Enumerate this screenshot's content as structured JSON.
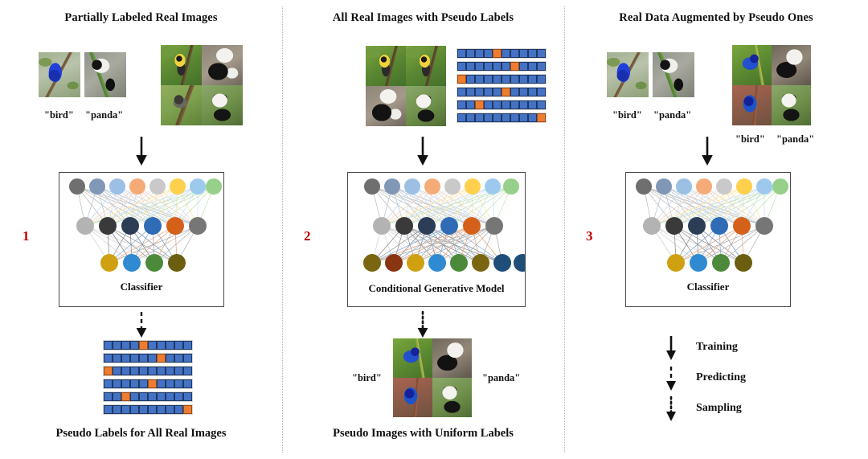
{
  "columns": [
    {
      "step": "1",
      "title": "Partially Labeled Real Images",
      "labeled": {
        "bird": "\"bird\"",
        "panda": "\"panda\""
      },
      "model": {
        "caption": "Classifier"
      },
      "bottom_caption": "Pseudo Labels for All Real Images",
      "arrow_in": "training-arrow-solid",
      "arrow_out": "predicting-arrow-dashed"
    },
    {
      "step": "2",
      "title": "All Real Images with Pseudo Labels",
      "model": {
        "caption": "Conditional Generative Model"
      },
      "output_labels": {
        "bird": "\"bird\"",
        "panda": "\"panda\""
      },
      "bottom_caption": "Pseudo Images with Uniform Labels",
      "arrow_in": "training-arrow-solid",
      "arrow_out": "sampling-arrow-dotted"
    },
    {
      "step": "3",
      "title": "Real Data Augmented by Pseudo Ones",
      "labeled": {
        "bird": "\"bird\"",
        "panda": "\"panda\""
      },
      "pseudo_labeled": {
        "bird": "\"bird\"",
        "panda": "\"panda\""
      },
      "model": {
        "caption": "Classifier"
      },
      "arrow_in": "training-arrow-solid"
    }
  ],
  "legend": {
    "items": [
      {
        "label": "Training",
        "style": "solid"
      },
      {
        "label": "Predicting",
        "style": "dashed"
      },
      {
        "label": "Sampling",
        "style": "dotted"
      }
    ]
  },
  "label_grid": {
    "rows": 6,
    "cols": 10,
    "hot_index_per_row": [
      4,
      6,
      0,
      5,
      2,
      9
    ],
    "cell_color": "#4472c4",
    "hot_color": "#ed7d31"
  },
  "network_small": {
    "layers": [
      [
        "#706f6f",
        "#8097b6",
        "#9cc0e3",
        "#f4ab78",
        "#c9c9c9",
        "#ffd04d",
        "#9dc9ef",
        "#97d08a"
      ],
      [
        "#b3b3b3",
        "#3a3a3a",
        "#2c3e56",
        "#2f6cb5",
        "#d4601a",
        "#767676"
      ],
      [
        "#cfa111",
        "#2f8ad1",
        "#4b8a3b",
        "#6b5e10"
      ]
    ]
  },
  "network_large": {
    "layers": [
      [
        "#706f6f",
        "#8097b6",
        "#9cc0e3",
        "#f4ab78",
        "#c9c9c9",
        "#ffd04d",
        "#9dc9ef",
        "#97d08a"
      ],
      [
        "#b3b3b3",
        "#3a3a3a",
        "#2c3e56",
        "#2f6cb5",
        "#d4601a",
        "#767676"
      ],
      [
        "#7a6610",
        "#8a3512",
        "#cfa111",
        "#2f8ad1",
        "#4b8a3b",
        "#7a6610",
        "#1f4e79",
        "#1f4e79"
      ]
    ]
  },
  "accent_color": "#c00000",
  "divider_color": "#b5b5b5"
}
